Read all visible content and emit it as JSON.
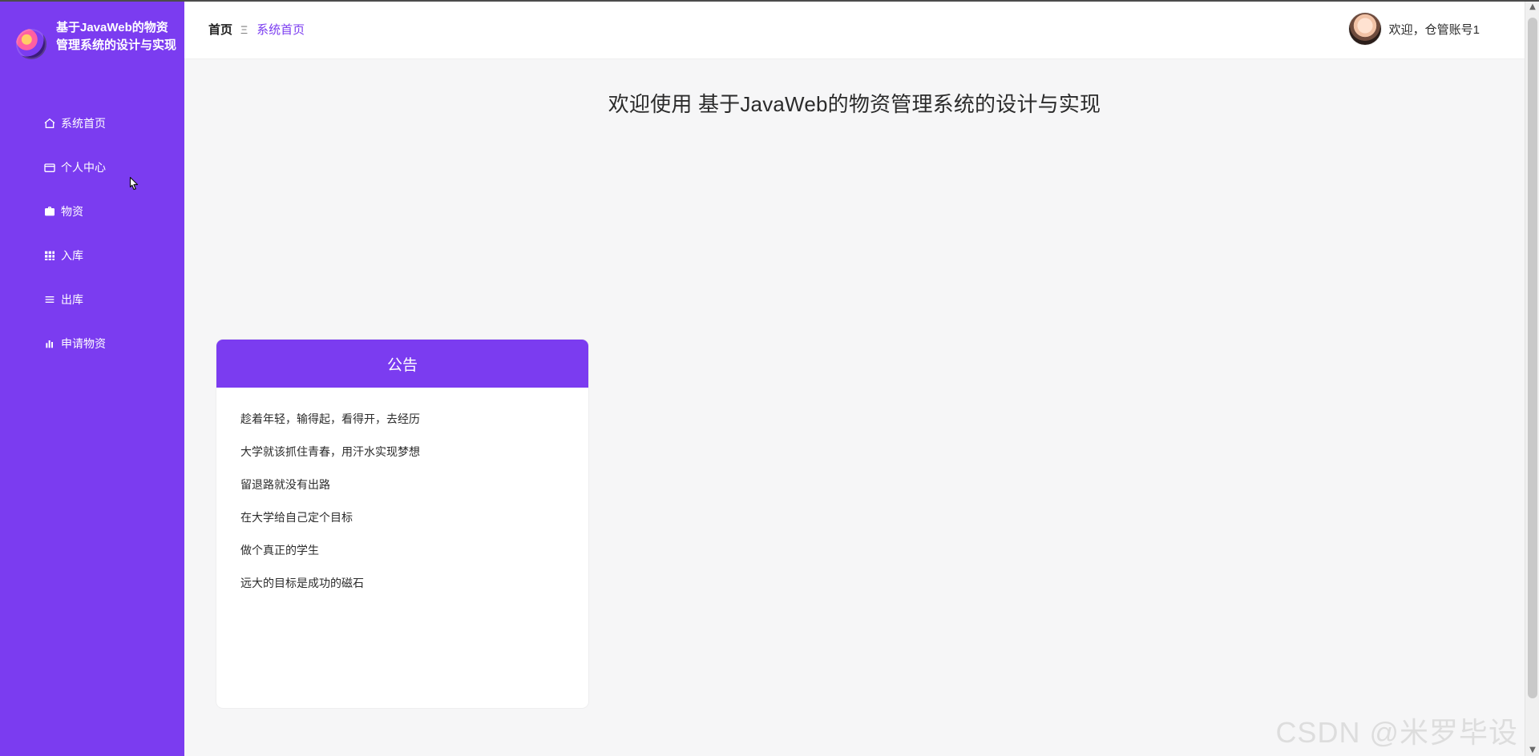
{
  "brand": {
    "title": "基于JavaWeb的物资管理系统的设计与实现"
  },
  "sidebar": {
    "items": [
      {
        "label": "系统首页",
        "icon": "home-icon"
      },
      {
        "label": "个人中心",
        "icon": "wallet-icon"
      },
      {
        "label": "物资",
        "icon": "briefcase-icon"
      },
      {
        "label": "入库",
        "icon": "grid-icon"
      },
      {
        "label": "出库",
        "icon": "list-icon"
      },
      {
        "label": "申请物资",
        "icon": "bar-chart-icon"
      }
    ]
  },
  "topbar": {
    "breadcrumb": {
      "home": "首页",
      "separator": "Ξ",
      "current": "系统首页"
    },
    "user": {
      "greeting": "欢迎，仓管账号1"
    }
  },
  "main": {
    "welcome": "欢迎使用 基于JavaWeb的物资管理系统的设计与实现",
    "notice": {
      "title": "公告",
      "items": [
        "趁着年轻，输得起，看得开，去经历",
        "大学就该抓住青春，用汗水实现梦想",
        "留退路就没有出路",
        "在大学给自己定个目标",
        "做个真正的学生",
        "远大的目标是成功的磁石"
      ]
    }
  },
  "overlay": {
    "watermark": "CSDN @米罗毕设"
  },
  "colors": {
    "sidebar": "#7b3cf0",
    "accent": "#7b3cf0",
    "background": "#f6f6f7"
  }
}
